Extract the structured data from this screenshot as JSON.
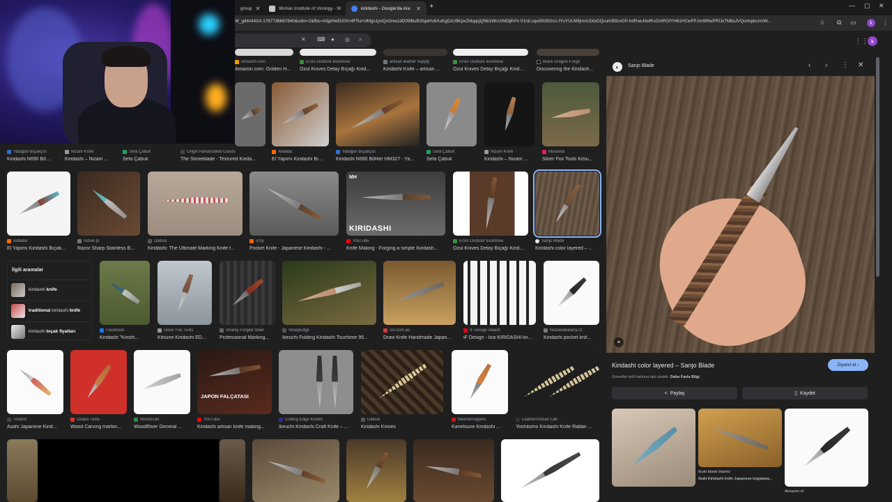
{
  "browser": {
    "tabs": [
      {
        "title": "group"
      },
      {
        "title": "Wuhan Institute of Virology - W"
      },
      {
        "title": "kiridashi - Google'da Ara"
      }
    ],
    "url": "W_g44z44XA:1767736687840&udm=2&fbs=AIIjpHw5U0Xn4FRaYdhfgs1jmQvOnw1dD09iBuB2fsjeHv6XuKgDzU9KpxZMqqsjQNb1WcUrMDj8VH-V1nIl.cqw5935Gn1-fYuYUUWljmnUGtxDQcuhrB9zvGP-hdRwuNwfKsGmRGfYH61HCwFPJnrt8RwPRfJx7M8sJVQorlopkvzmW..."
  },
  "search": {
    "query": ""
  },
  "grid": {
    "row0": [
      {
        "source": "Amazon.com",
        "caption": "Amazon.com: Golden H..."
      },
      {
        "source": "Ersin Outdoor Bushlove",
        "caption": "Ozul Knives Detay Bıçağı Kirid..."
      },
      {
        "source": "artisan leather supply",
        "caption": "Kiridashi Knife – artisan ..."
      },
      {
        "source": "Ersin Outdoor Bushlove",
        "caption": "Ozul Knives Detay Bıçağı Kirid..."
      },
      {
        "source": "Black Dragon Forge",
        "caption": "Discovering the Kiridash..."
      }
    ],
    "row1": [
      {
        "source": "Yatağan Bıçakçısı",
        "caption": "Kiridashi N690 Bö..."
      },
      {
        "source": "Nizam Knife",
        "caption": "Kiridashi – Nizam ..."
      },
      {
        "source": "Sefa Çabuk",
        "caption": "Sefa Çabuk"
      },
      {
        "source": "Origin Handcrafted Goods",
        "caption": "The Stoneblade - Textured Kirida..."
      },
      {
        "source": "Alibaba",
        "caption": "El Yapımı Kiridashi Bı..."
      },
      {
        "source": "Yatağan Bıçakçısı",
        "caption": "Kiridashi N690 Böhler HM327 - Ya..."
      },
      {
        "source": "Sefa Çabuk",
        "caption": "Sefa Çabuk"
      },
      {
        "source": "Nizam Knife",
        "caption": "Kiridashi – Nizam ..."
      },
      {
        "source": "Mukama",
        "caption": "Silver Fox Tools Kitsu..."
      }
    ],
    "row2": [
      {
        "source": "Alibaba",
        "caption": "El Yapımı Kiridashi Bıçak..."
      },
      {
        "source": "sobuk.pl",
        "caption": "Razor Sharp Stainless B..."
      },
      {
        "source": "Dalloul",
        "caption": "Kiridashi: The Ultimate Marking Knife f..."
      },
      {
        "source": "Etsy",
        "caption": "Pocket Knife - Japanese Kiridashi - ..."
      },
      {
        "source": "YouTube",
        "caption": "Knife Making - Forging a simple Kiridash..."
      },
      {
        "source": "Ersin Outdoor Bushlove",
        "caption": "Ozul Knives Detay Bıçağı Kirid..."
      },
      {
        "source": "Sanjo Blade",
        "caption": "Kiridashi color layered – ..."
      }
    ],
    "kiridashi_overlay": "KIRIDASHI",
    "row3": [
      {
        "source": "Facebook",
        "caption": "Kiridashi \"Kirishi..."
      },
      {
        "source": "Silver Fox Tools",
        "caption": "Kitsune Kiridashi ED..."
      },
      {
        "source": "Sharky Forged Steel",
        "caption": "Professional Marking..."
      },
      {
        "source": "SharpEdge",
        "caption": "Ikeuchi Folding Kiridashi Tsuchime 95..."
      },
      {
        "source": "col.com.au",
        "caption": "Draw Knife Handmade Japan..."
      },
      {
        "source": "iF Design Award",
        "caption": "iF Design - liza KIRIDASHI kn..."
      },
      {
        "source": "Nozawakatany.cz",
        "caption": "Kiridashi pocket knif..."
      }
    ],
    "row4": [
      {
        "source": "Toolnut",
        "caption": "Asahi Japanese Kirid..."
      },
      {
        "source": "Osaka Tools",
        "caption": "Wood Carving markin..."
      },
      {
        "source": "Woodcraft",
        "caption": "WoodRiver General ..."
      },
      {
        "source": "YouTube",
        "caption": "Kiridashi artisan knife making..."
      },
      {
        "source": "Cutting Edge Knives",
        "caption": "Ikeuchi Kiridashi Craft Knife – ..."
      },
      {
        "source": "Dalloul",
        "caption": "Kiridashi Knives"
      },
      {
        "source": "Meesterslijpers",
        "caption": "Kanetsune Kiridashi ..."
      },
      {
        "source": "LeatherArtisan Lab",
        "caption": "Yoshitomo Kiridashi Knife Rattan ..."
      }
    ],
    "youtube_overlay": "JAPON FALÇATASI",
    "mh_overlay": "MH"
  },
  "related": {
    "title": "İlgili aramalar",
    "items": [
      {
        "prefix": "kiridashi ",
        "bold": "knife",
        "suffix": ""
      },
      {
        "prefix": "",
        "bold": "traditional",
        "middle": " kiridashi ",
        "bold2": "knife"
      },
      {
        "prefix": "kiridashi ",
        "bold": "bıçak fiyatları",
        "suffix": ""
      }
    ]
  },
  "panel": {
    "source": "Sanjo Blade",
    "title": "Kiridashi color layered – Sanjo Blade",
    "visit": "Ziyaret et",
    "note_prefix": "Görseller telif hakkına tabi olabilir.",
    "note_link": "Daha Fazla Bilgi",
    "share": "Paylaş",
    "save": "Kaydet",
    "related": [
      {
        "source": "",
        "caption": ""
      },
      {
        "source": "ibuki blade blanks",
        "caption": "Ibuki Kiridashi knife Japanese kogatana..."
      },
      {
        "source": "Amazon.nl",
        "caption": ""
      }
    ]
  },
  "avatar_letter": "k"
}
